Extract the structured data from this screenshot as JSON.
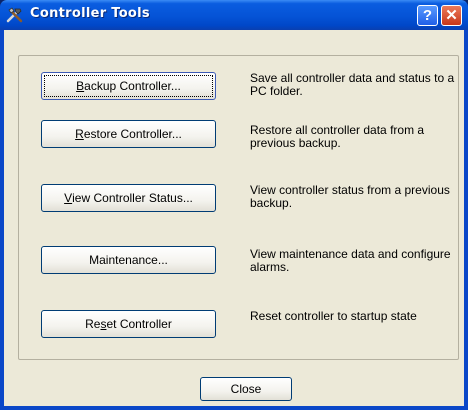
{
  "window": {
    "title": "Controller Tools",
    "help_glyph": "?",
    "close_glyph": "✕"
  },
  "actions": [
    {
      "label_pre": "",
      "label_u": "B",
      "label_post": "ackup Controller...",
      "description": "Save all controller data and status to a PC folder."
    },
    {
      "label_pre": "",
      "label_u": "R",
      "label_post": "estore Controller...",
      "description": "Restore all controller data from a previous backup."
    },
    {
      "label_pre": "",
      "label_u": "V",
      "label_post": "iew Controller Status...",
      "description": "View controller status from a previous backup."
    },
    {
      "label_pre": "Maintenance...",
      "label_u": "",
      "label_post": "",
      "description": "View maintenance data and configure alarms."
    },
    {
      "label_pre": "Re",
      "label_u": "s",
      "label_post": "et Controller",
      "description": "Reset controller to startup state"
    }
  ],
  "close_button": "Close",
  "icons": {
    "title_icon": "tools-icon"
  },
  "colors": {
    "titlebar": "#0553d6",
    "client_bg": "#ece9d8",
    "button_border": "#003c74"
  }
}
